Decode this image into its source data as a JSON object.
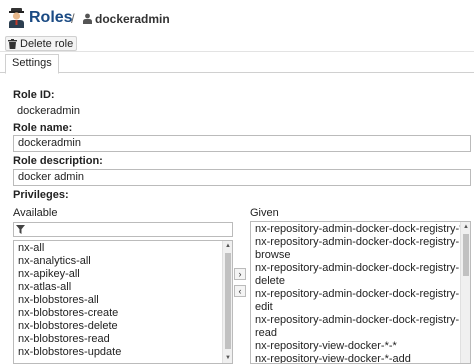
{
  "header": {
    "title": "Roles",
    "separator": "/",
    "breadcrumb_user": "dockeradmin"
  },
  "toolbar": {
    "delete_label": "Delete role"
  },
  "tabs": [
    {
      "label": "Settings"
    }
  ],
  "form": {
    "role_id_label": "Role ID:",
    "role_id_value": "dockeradmin",
    "role_name_label": "Role name:",
    "role_name_value": "dockeradmin",
    "role_description_label": "Role description:",
    "role_description_value": "docker admin",
    "privileges_label": "Privileges:",
    "available_label": "Available",
    "given_label": "Given",
    "filter_value": ""
  },
  "available_items": [
    "nx-all",
    "nx-analytics-all",
    "nx-apikey-all",
    "nx-atlas-all",
    "nx-blobstores-all",
    "nx-blobstores-create",
    "nx-blobstores-delete",
    "nx-blobstores-read",
    "nx-blobstores-update"
  ],
  "given_items": [
    "nx-repository-admin-docker-dock-registry-*",
    "nx-repository-admin-docker-dock-registry-",
    "browse",
    "nx-repository-admin-docker-dock-registry-",
    "delete",
    "nx-repository-admin-docker-dock-registry-",
    "edit",
    "nx-repository-admin-docker-dock-registry-",
    "read",
    "nx-repository-view-docker-*-*",
    "nx-repository-view-docker-*-add"
  ],
  "move_buttons": {
    "add": "›",
    "remove": "‹"
  },
  "scrollbar_arrows": {
    "up": "▲",
    "down": "▼"
  },
  "colors": {
    "title": "#1a4a83",
    "border": "#bbbbbb"
  },
  "icons": {
    "role": "role-avatar-icon",
    "user": "user-icon",
    "delete": "trash-icon",
    "filter": "filter-icon"
  }
}
